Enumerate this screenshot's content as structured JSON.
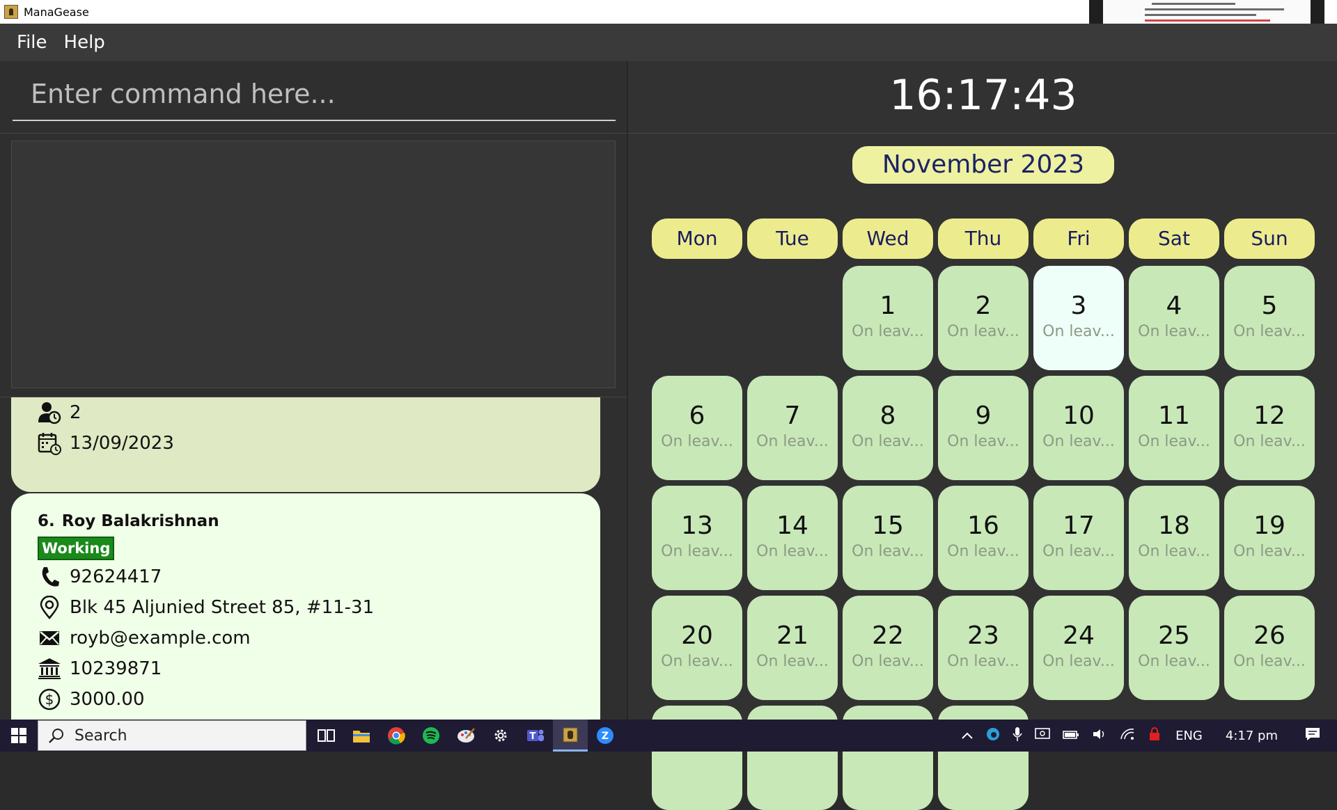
{
  "window": {
    "title": "ManaGease"
  },
  "menu": {
    "file": "File",
    "help": "Help"
  },
  "command": {
    "placeholder": "Enter command here..."
  },
  "list": {
    "card5": {
      "leave_days": "2",
      "join_date": "13/09/2023"
    },
    "card6": {
      "index": "6.",
      "name": "Roy Balakrishnan",
      "status": "Working",
      "phone": "92624417",
      "address": "Blk 45 Aljunied Street 85, #11-31",
      "email": "royb@example.com",
      "bank": "10239871",
      "salary": "3000.00"
    }
  },
  "clock": {
    "time": "16:17:43"
  },
  "calendar": {
    "month": "November 2023",
    "weekdays": [
      "Mon",
      "Tue",
      "Wed",
      "Thu",
      "Fri",
      "Sat",
      "Sun"
    ],
    "leave_label": "On leav...",
    "today": 3,
    "first_weekday_index": 2,
    "visible_days": [
      1,
      2,
      3,
      4,
      5,
      6,
      7,
      8,
      9,
      10,
      11,
      12,
      13,
      14,
      15,
      16,
      17,
      18,
      19,
      20,
      21,
      22,
      23,
      24,
      25,
      26
    ]
  },
  "taskbar": {
    "search": "Search",
    "language": "ENG",
    "time": "4:17 pm"
  },
  "icons": {
    "phone": "phone-icon",
    "location": "location-pin-icon",
    "email": "envelope-icon",
    "bank": "bank-icon",
    "salary": "dollar-icon",
    "leave": "person-clock-icon",
    "date": "calendar-clock-icon"
  }
}
